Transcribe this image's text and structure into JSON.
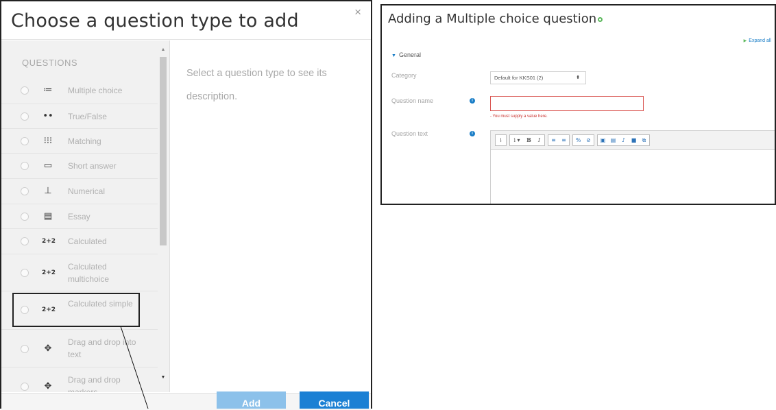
{
  "dialog": {
    "title": "Choose a question type to add",
    "close": "×",
    "heading": "QUESTIONS",
    "description": "Select a question type to see its description.",
    "items": [
      {
        "label": "Multiple choice",
        "icon": "≔",
        "icon_name": "list-icon"
      },
      {
        "label": "True/False",
        "icon": "••",
        "icon_name": "dots-icon"
      },
      {
        "label": "Matching",
        "icon": "⁝⁝⁝",
        "icon_name": "matching-icon"
      },
      {
        "label": "Short answer",
        "icon": "▭",
        "icon_name": "short-answer-icon"
      },
      {
        "label": "Numerical",
        "icon": "⊥",
        "icon_name": "numerical-icon"
      },
      {
        "label": "Essay",
        "icon": "▤",
        "icon_name": "essay-icon"
      },
      {
        "label": "Calculated",
        "icon": "2+2",
        "icon_name": "calculated-icon"
      },
      {
        "label": "Calculated multichoice",
        "icon": "2+2",
        "icon_name": "calculated-multichoice-icon"
      },
      {
        "label": "Calculated simple",
        "icon": "2+2",
        "icon_name": "calculated-simple-icon"
      },
      {
        "label": "Drag and drop into text",
        "icon": "✥",
        "icon_name": "drag-drop-text-icon"
      },
      {
        "label": "Drag and drop markers",
        "icon": "✥",
        "icon_name": "drag-drop-markers-icon"
      }
    ],
    "add_label": "Add",
    "cancel_label": "Cancel"
  },
  "form": {
    "title": "Adding a Multiple choice question",
    "expand_all": "Expand all",
    "section": "General",
    "category_label": "Category",
    "category_value": "Default for KKS01 (2)",
    "name_label": "Question name",
    "name_error": "- You must supply a value here.",
    "text_label": "Question text",
    "info_glyph": "i",
    "toolbar": [
      [
        "⇂"
      ],
      [
        "i ▾",
        "B",
        "I"
      ],
      [
        "≡",
        "≡"
      ],
      [
        "%",
        "⊘"
      ],
      [
        "▣",
        "▤",
        "♪",
        "■",
        "⧉"
      ]
    ]
  },
  "colors": {
    "accent": "#1b80d4",
    "add_button": "#8cc1ea",
    "error": "#d9534f",
    "success": "#5cb85c"
  }
}
